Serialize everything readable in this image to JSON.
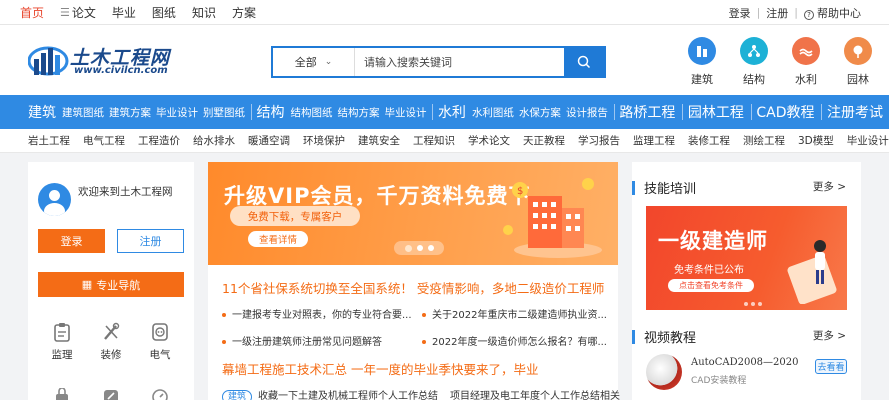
{
  "topnav": {
    "items": [
      "首页",
      "论文",
      "毕业",
      "图纸",
      "知识",
      "方案"
    ],
    "active": "首页",
    "right": {
      "login": "登录",
      "sep": "|",
      "register": "注册",
      "help": "帮助中心"
    }
  },
  "header": {
    "logo_text": "土木工程网",
    "logo_url": "www.civilcn.com",
    "search": {
      "scope": "全部",
      "placeholder": "请输入搜索关键词"
    },
    "categories": [
      {
        "label": "建筑",
        "color": "#2f8ae3"
      },
      {
        "label": "结构",
        "color": "#1db1d6"
      },
      {
        "label": "水利",
        "color": "#f0734a"
      },
      {
        "label": "园林",
        "color": "#f08b4a"
      }
    ]
  },
  "bluenav": {
    "groups": [
      {
        "big": "建筑",
        "items": [
          "建筑图纸",
          "建筑方案",
          "毕业设计",
          "别墅图纸"
        ]
      },
      {
        "big": "结构",
        "items": [
          "结构图纸",
          "结构方案",
          "毕业设计"
        ]
      },
      {
        "big": "水利",
        "items": [
          "水利图纸",
          "水保方案",
          "设计报告"
        ]
      },
      {
        "big": "路桥工程",
        "items": []
      },
      {
        "big": "园林工程",
        "items": []
      },
      {
        "big": "CAD教程",
        "items": []
      },
      {
        "big": "注册考试",
        "items": []
      }
    ]
  },
  "subnav": [
    "岩土工程",
    "电气工程",
    "工程造价",
    "给水排水",
    "暖通空调",
    "环境保护",
    "建筑安全",
    "工程知识",
    "学术论文",
    "天正教程",
    "学习报告",
    "监理工程",
    "装修工程",
    "测绘工程",
    "3D模型",
    "毕业设计"
  ],
  "left": {
    "welcome": "欢迎来到土木工程网",
    "login_btn": "登录",
    "register_btn": "注册",
    "nav_btn": "专业导航",
    "tools": [
      "监理",
      "装修",
      "电气"
    ]
  },
  "middle": {
    "banner": {
      "title": "升级VIP会员，千万资料免费下",
      "pill": "免费下载，专属客户",
      "detail": "查看详情"
    },
    "headline1": "11个省社保系统切换至全国系统！ 受疫情影响，多地二级造价工程师",
    "list1": [
      "一建报考专业对照表，你的专业符合要...",
      "关于2022年重庆市二级建造师执业资...",
      "一级注册建筑师注册常见问题解答",
      "2022年度一级造价师怎么报名？有哪..."
    ],
    "headline2": "幕墙工程施工技术汇总  一年一度的毕业季快要来了，毕业",
    "tag": "建筑",
    "list2": [
      "收藏一下土建及机械工程师个人工作总结",
      "项目经理及电工年度个人工作总结相关"
    ]
  },
  "right": {
    "section1": "技能培训",
    "more": "更多",
    "banner": {
      "title": "一级建造师",
      "sub": "免考条件已公布",
      "btn": "点击查看免考条件"
    },
    "section2": "视频教程",
    "video": {
      "title": "AutoCAD2008—2020",
      "sub": "CAD安装教程",
      "go": "去看看"
    }
  }
}
